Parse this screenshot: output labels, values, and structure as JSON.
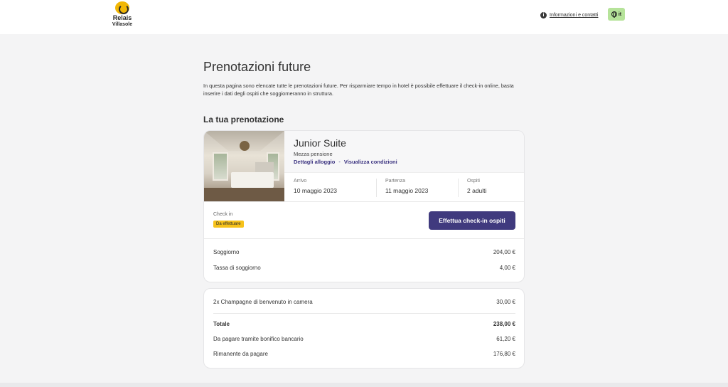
{
  "header": {
    "logo_line1": "Relais",
    "logo_line2": "Villasole",
    "info_link": "Informazioni e contatti",
    "language": "it"
  },
  "page": {
    "title": "Prenotazioni future",
    "intro": "In questa pagina sono elencate tutte le prenotazioni future. Per risparmiare tempo in hotel è possibile effettuare il check-in online, basta inserire i dati degli ospiti che soggiorneranno in struttura.",
    "section_title": "La tua prenotazione"
  },
  "booking": {
    "room_name": "Junior Suite",
    "board": "Mezza pensione",
    "link_details": "Dettagli alloggio",
    "link_separator": "-",
    "link_conditions": "Visualizza condizioni",
    "arrival_label": "Arrivo",
    "arrival_value": "10 maggio 2023",
    "departure_label": "Partenza",
    "departure_value": "11 maggio 2023",
    "guests_label": "Ospiti",
    "guests_value": "2 adulti",
    "checkin_label": "Check in",
    "checkin_status": "Da effettuare",
    "checkin_button": "Effettua check-in ospiti"
  },
  "prices": {
    "stay_label": "Soggiorno",
    "stay_value": "204,00 €",
    "tax_label": "Tassa di soggiorno",
    "tax_value": "4,00 €"
  },
  "extras": {
    "extra_label": "2x Champagne di benvenuto in camera",
    "extra_value": "30,00 €",
    "total_label": "Totale",
    "total_value": "238,00 €",
    "transfer_label": "Da pagare tramite bonifico bancario",
    "transfer_value": "61,20 €",
    "remaining_label": "Rimanente da pagare",
    "remaining_value": "176,80 €"
  },
  "colors": {
    "accent": "#403a7e",
    "badge": "#f6c21b",
    "language_button": "#b6e39a"
  }
}
